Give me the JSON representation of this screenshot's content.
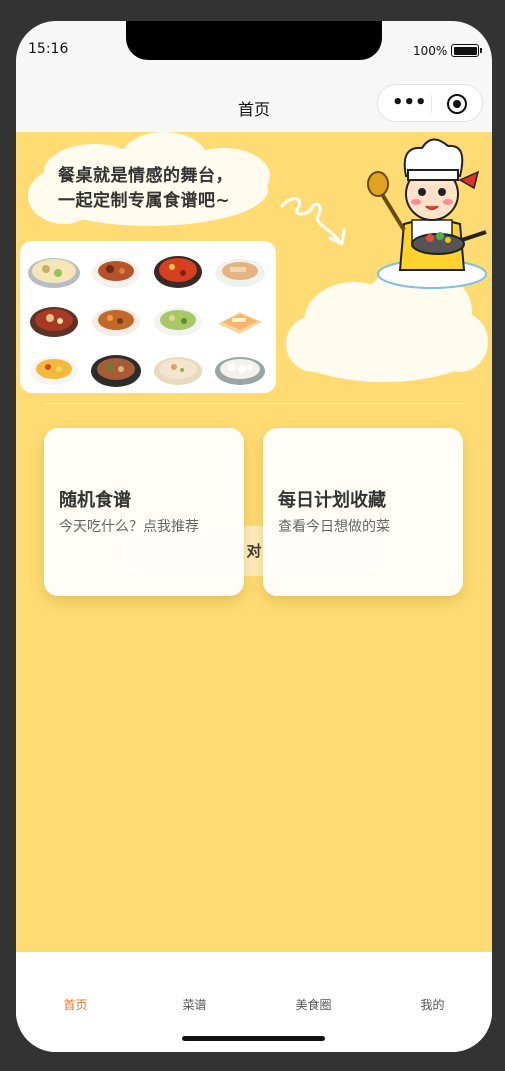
{
  "status_bar": {
    "time": "15:16",
    "battery": "100%"
  },
  "nav": {
    "title": "首页",
    "more_icon": "more-dots-icon",
    "close_icon": "target-circle-icon"
  },
  "hero": {
    "slogan_line1": "餐桌就是情感的舞台，",
    "slogan_line2": "一起定制专属食谱吧~",
    "dishes": [
      "dish-1",
      "dish-2",
      "dish-3",
      "dish-4",
      "dish-5",
      "dish-6",
      "dish-7",
      "dish-8",
      "dish-9",
      "dish-10",
      "dish-11",
      "dish-12"
    ]
  },
  "cards": {
    "random": {
      "title": "随机食谱",
      "subtitle": "今天吃什么？点我推荐"
    },
    "daily": {
      "title": "每日计划收藏",
      "subtitle": "查看今日想做的菜"
    }
  },
  "hidden_button": {
    "visible_char": "对"
  },
  "tabbar": {
    "items": [
      {
        "label": "首页",
        "active": true
      },
      {
        "label": "菜谱",
        "active": false
      },
      {
        "label": "美食圈",
        "active": false
      },
      {
        "label": "我的",
        "active": false
      }
    ]
  },
  "colors": {
    "background": "#fedc73",
    "accent": "#e0742b",
    "frame": "#333333"
  }
}
